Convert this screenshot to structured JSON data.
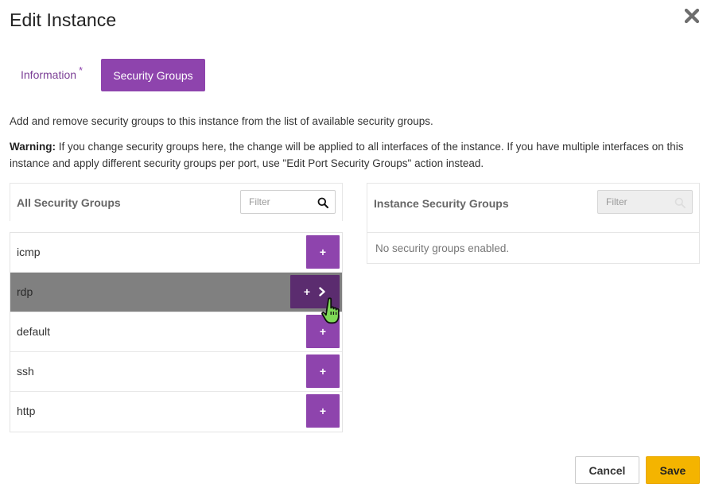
{
  "dialog": {
    "title": "Edit Instance",
    "close_icon": "close-x-icon"
  },
  "tabs": [
    {
      "label": "Information",
      "required_marker": "*",
      "active": false
    },
    {
      "label": "Security Groups",
      "active": true
    }
  ],
  "description": "Add and remove security groups to this instance from the list of available security groups.",
  "warning": {
    "label": "Warning:",
    "text": "If you change security groups here, the change will be applied to all interfaces of the instance. If you have multiple interfaces on this instance and apply different security groups per port, use \"Edit Port Security Groups\" action instead."
  },
  "available": {
    "title": "All Security Groups",
    "filter_placeholder": "Filter",
    "items": [
      {
        "name": "icmp",
        "action": "+"
      },
      {
        "name": "rdp",
        "action": "+",
        "hovered": true
      },
      {
        "name": "default",
        "action": "+"
      },
      {
        "name": "ssh",
        "action": "+"
      },
      {
        "name": "http",
        "action": "+"
      }
    ]
  },
  "allocated": {
    "title": "Instance Security Groups",
    "filter_placeholder": "Filter",
    "empty_text": "No security groups enabled."
  },
  "footer": {
    "cancel_label": "Cancel",
    "save_label": "Save"
  },
  "colors": {
    "accent": "#8e44ad",
    "accent_dark": "#5b2c6f",
    "hover_row": "#808080",
    "save": "#f4b400"
  }
}
